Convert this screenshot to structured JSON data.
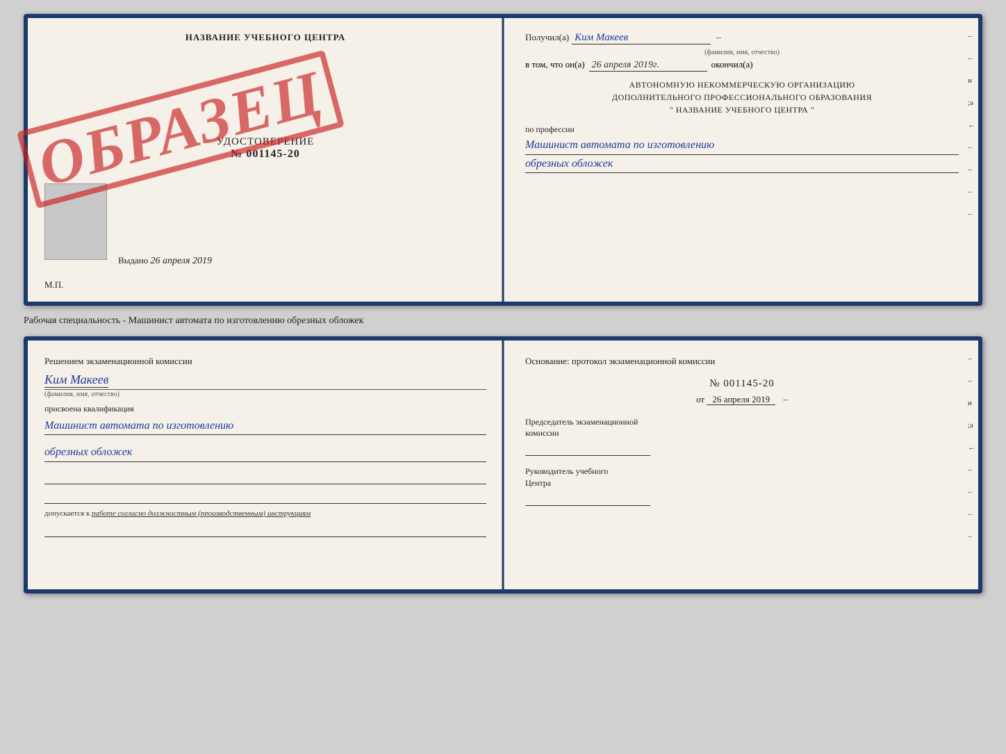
{
  "top_cert": {
    "left": {
      "title": "НАЗВАНИЕ УЧЕБНОГО ЦЕНТРА",
      "sample_stamp": "ОБРАЗЕЦ",
      "udost_label": "УДОСТОВЕРЕНИЕ",
      "number": "№ 001145-20",
      "vydano_label": "Выдано",
      "vydano_date": "26 апреля 2019",
      "mp_label": "М.П."
    },
    "right": {
      "получил_label": "Получил(а)",
      "получил_name": "Ким Макеев",
      "фио_sub": "(фамилия, имя, отчество)",
      "dash1": "–",
      "в_том_label": "в том, что он(а)",
      "дата_val": "26 апреля 2019г.",
      "окончил_label": "окончил(а)",
      "block_line1": "АВТОНОМНУЮ НЕКОММЕРЧЕСКУЮ ОРГАНИЗАЦИЮ",
      "block_line2": "ДОПОЛНИТЕЛЬНОГО ПРОФЕССИОНАЛЬНОГО ОБРАЗОВАНИЯ",
      "block_line3": "\"  НАЗВАНИЕ УЧЕБНОГО ЦЕНТРА  \"",
      "right_dash1": "–",
      "right_и": "и",
      "right_а": "а",
      "right_стрелка": "←",
      "profession_label": "по профессии",
      "profession_line1": "Машинист автомата по изготовлению",
      "profession_line2": "обрезных обложек",
      "dash_marks": [
        "–",
        "–",
        "–",
        "–"
      ]
    }
  },
  "specialty_line": {
    "text": "Рабочая специальность - Машинист автомата по изготовлению обрезных обложек"
  },
  "lower_cert": {
    "left": {
      "решением_label": "Решением экзаменационной комиссии",
      "name": "Ким Макеев",
      "фио_sub": "(фамилия, имя, отчество)",
      "присвоена_label": "присвоена квалификация",
      "qualification_line1": "Машинист автомата по изготовлению",
      "qualification_line2": "обрезных обложек",
      "допускается_prefix": "допускается к",
      "допускается_text": "работе согласно должностным (производственным) инструкциям"
    },
    "right": {
      "основание_label": "Основание: протокол экзаменационной комиссии",
      "number": "№  001145-20",
      "от_label": "от",
      "date": "26 апреля 2019",
      "председатель_label": "Председатель экзаменационной",
      "председатель_label2": "комиссии",
      "руководитель_label": "Руководитель учебного",
      "руководитель_label2": "Центра",
      "right_dash1": "–",
      "right_dash2": "–",
      "right_и": "и",
      "right_а": "а",
      "right_стрелка": "←",
      "dash_marks_right": [
        "–",
        "–",
        "–",
        "–"
      ]
    }
  }
}
